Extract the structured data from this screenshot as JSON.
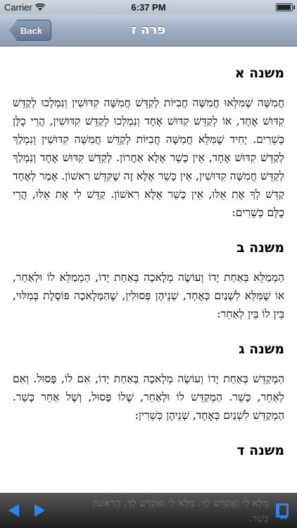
{
  "status_bar": {
    "carrier": "Carrier",
    "time": "6:37 PM",
    "battery_level": 0.95
  },
  "nav": {
    "back_label": "Back",
    "title": "פרה ז"
  },
  "mishnayot": [
    {
      "heading": "משנה א",
      "text": "חֲמִשָּׁה שֶׁמִּלְּאוּ חֲמִשָּׁה חֲבִיּוֹת לְקַדֵּשׁ חֲמִשָּׁה קִדּוּשִׁין וְנִמְלְכוּ לְקַדֵּשׁ קִדּוּשׁ אֶחָד, אוֹ לְקַדֵּשׁ קִדּוּשׁ אֶחָד וְנִמְלְכוּ לְקַדֵּשׁ קִדּוּשִׁין, הֲרֵי כֻלָּן כְּשֵׁרִים. יָחִיד שֶׁמִּלֵּא חֲמִשָּׁה חֲבִיּוֹת לְקַדֵּשׁ חֲמִשָּׁה קִדּוּשִׁין וְנִמְלַךְ לְקַדֵּשׁ קִדּוּשׁ אֶחָד, אֵין כָּשֵׁר אֶלָּא אַחֲרוֹן. לְקַדֵּשׁ קִדּוּשׁ אֶחָד וְנִמְלַךְ לְקַדֵּשׁ חֲמִשָּׁה קִדּוּשִׁין, אֵין כָּשֵׁר אֶלָּא זֶה שֶׁקִּדֵּשׁ רִאשׁוֹן. אָמַר לְאֶחָד קַדֵּשׁ לְךָ אֶת אֵלּוּ, אֵין כָּשֵׁר אֶלָּא רִאשׁוֹן. קַדֵּשׁ לִי אֶת אֵלּוּ, הֲרֵי כֻלָּם כְּשֵׁרִים:"
    },
    {
      "heading": "משנה ב",
      "text": "הַמְמַלֵּא בְּאַחַת יָדוֹ וְעוֹשֶׂה מְלָאכָה בְּאַחַת יָדוֹ, הַמְמַלֵּא לוֹ וּלְאַחֵר, אוֹ שֶׁמִּלֵּא לִשְׁנַיִם כְּאֶחָד, שְׁנֵיהֶן פְּסוּלִין, שֶׁהַמְּלָאכָה פּוֹסֶלֶת בְּמִלּוּי, בֵּין לוֹ בֵּין לְאַחֵר:"
    },
    {
      "heading": "משנה ג",
      "text": "הַמְקַדֵּשׁ בְּאַחַת יָדוֹ וְעוֹשֶׂה מְלָאכָה בְּאַחַת יָדוֹ, אִם לוֹ, פָּסוּל. וְאִם לְאַחֵר, כָּשֵׁר. הַמְקַדֵּשׁ לוֹ וּלְאַחֵר, שֶׁלוֹ פָּסוּל, וְשֶׁל אַחֵר כָּשֵׁר. הַמְקַדֵּשׁ לִשְׁנַיִם כְּאֶחָד, שְׁנֵיהֶן כְּשֵׁרִין:"
    },
    {
      "heading": "משנה ד",
      "text": "מַלֵּא לִי וְאֲקַדֵּשׁ לָךְ. מַלֵּא לִי וְאַקְדֵּשׁ לָךְ, הָרִאשׁוֹן כָּשֵׁר."
    }
  ],
  "toolbar": {
    "prev_icon": "arrow-left-icon",
    "next_icon": "arrow-right-icon",
    "book_icon": "bookmark-icon",
    "accent": "#2a86f0"
  }
}
